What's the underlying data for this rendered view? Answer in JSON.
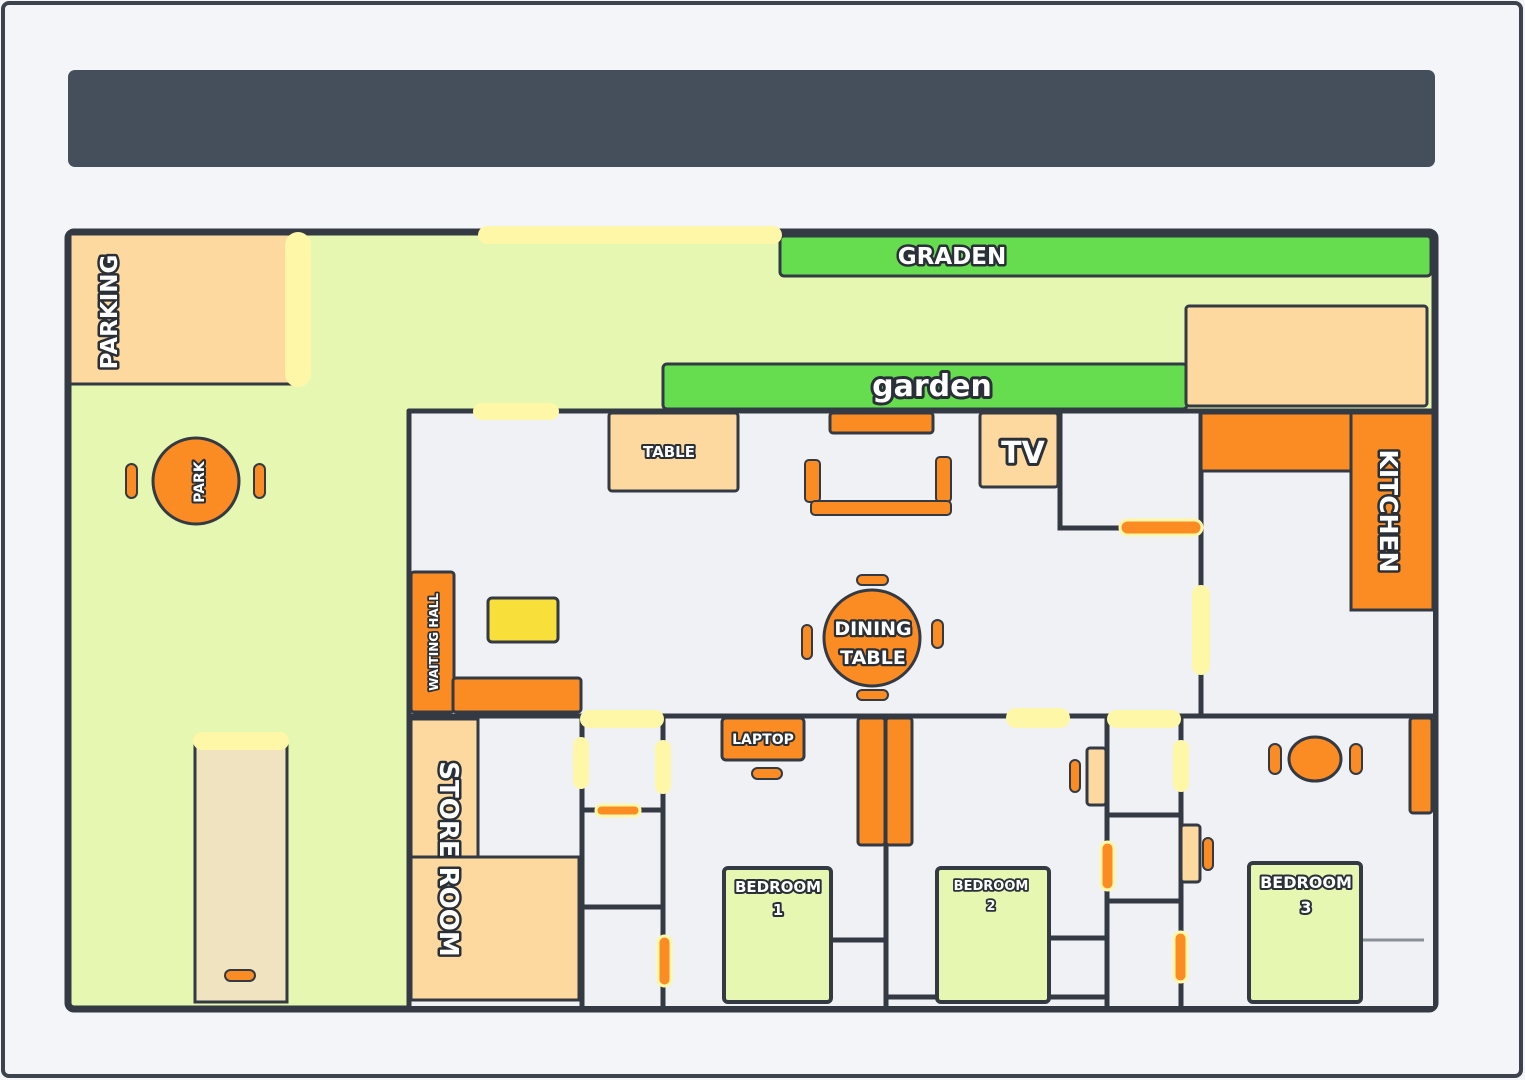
{
  "header": {
    "title": ""
  },
  "labels": {
    "parking": "PARKING",
    "graden": "GRADEN",
    "garden": "garden",
    "table": "TABLE",
    "tv": "TV",
    "kitchen": "KITCHEN",
    "park": "PARK",
    "waiting_hall": "WAITING HALL",
    "dining_line1": "DINING",
    "dining_line2": "TABLE",
    "laptop": "LAPTOP",
    "store_room": "STORE ROOM",
    "bedroom1_line1": "BEDROOM",
    "bedroom1_line2": "1",
    "bedroom2_line1": "BEDROOM",
    "bedroom2_line2": "2",
    "bedroom3_line1": "BEDROOM",
    "bedroom3_line2": "3"
  },
  "colors": {
    "lawn": "#e5f7b0",
    "wall": "#333a44",
    "floor": "#f0f1f5",
    "peach": "#fdd9a0",
    "orange": "#fb8c24",
    "green": "#66dd4f",
    "door": "#fef7a8",
    "yellow": "#f8df3a",
    "header": "#454f5c"
  }
}
